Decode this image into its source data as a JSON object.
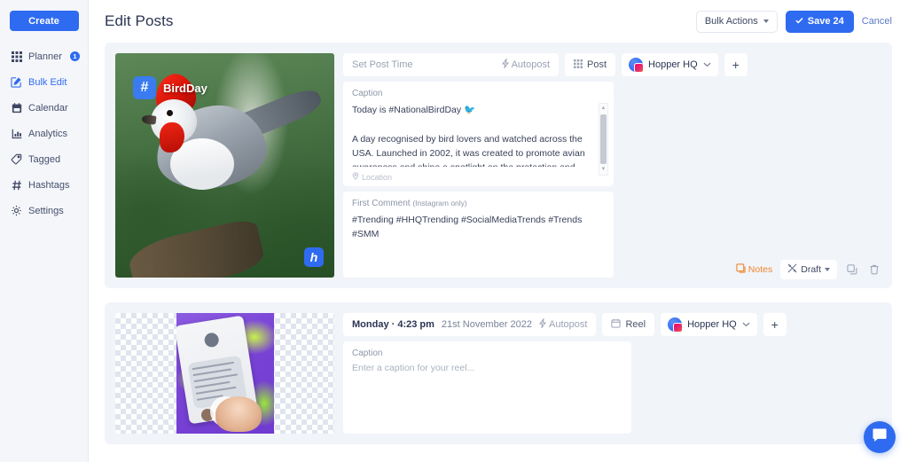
{
  "sidebar": {
    "create_label": "Create",
    "items": [
      {
        "label": "Planner",
        "icon": "grid-icon",
        "badge": "1",
        "active": false
      },
      {
        "label": "Bulk Edit",
        "icon": "pencil-square-icon",
        "badge": "",
        "active": true
      },
      {
        "label": "Calendar",
        "icon": "calendar-icon",
        "badge": "",
        "active": false
      },
      {
        "label": "Analytics",
        "icon": "bar-chart-icon",
        "badge": "",
        "active": false
      },
      {
        "label": "Tagged",
        "icon": "tag-icon",
        "badge": "",
        "active": false
      },
      {
        "label": "Hashtags",
        "icon": "hash-icon",
        "badge": "",
        "active": false
      },
      {
        "label": "Settings",
        "icon": "gear-icon",
        "badge": "",
        "active": false
      }
    ]
  },
  "header": {
    "title": "Edit Posts",
    "bulk_actions_label": "Bulk Actions",
    "save_label": "Save 24",
    "cancel_label": "Cancel"
  },
  "posts": [
    {
      "time_placeholder": "Set Post Time",
      "autopost_label": "Autopost",
      "type_label": "Post",
      "account_label": "Hopper HQ",
      "add_label": "+",
      "caption_label": "Caption",
      "caption_value": "Today is #NationalBirdDay 🐦\n\nA day recognised by bird lovers and watched across the USA. Launched in 2002, it was created to promote avian awareness and shine a spotlight on the protection and",
      "location_label": "Location",
      "comment_label": "First Comment",
      "comment_sub": "(Instagram only)",
      "comment_value": "#Trending #HHQTrending #SocialMediaTrends #Trends #SMM",
      "notes_label": "Notes",
      "draft_label": "Draft",
      "image_badge_label": "BirdDay",
      "image_logo_label": "h"
    },
    {
      "time_day": "Monday · 4:23 pm",
      "time_date": "21st November 2022",
      "autopost_label": "Autopost",
      "type_label": "Reel",
      "account_label": "Hopper HQ",
      "add_label": "+",
      "caption_label": "Caption",
      "caption_placeholder": "Enter a caption for your reel..."
    }
  ],
  "colors": {
    "accent": "#2f6bf0",
    "card_bg": "#f1f4f9",
    "sidebar_bg": "#f4f6fa",
    "notes": "#f0852c",
    "text": "#2b3553",
    "muted": "#9aa2b4"
  }
}
